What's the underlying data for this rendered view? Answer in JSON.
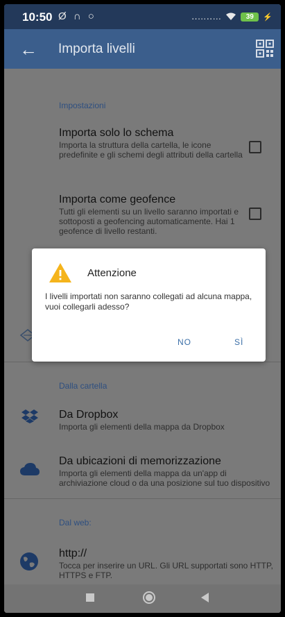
{
  "status_bar": {
    "time": "10:50",
    "left_icons": "Ø ∩ ○",
    "battery": "39",
    "signal": "‥…‥…",
    "charging": "⚡"
  },
  "app_bar": {
    "title": "Importa livelli"
  },
  "settings": {
    "header": "Impostazioni",
    "items": [
      {
        "title": "Importa solo lo schema",
        "description": "Importa la struttura della cartella, le icone predefinite e gli schemi degli attributi della cartella"
      },
      {
        "title": "Importa come geofence",
        "description": "Tutti gli elementi su un livello saranno importati e sottoposti a geofencing automaticamente. Hai 1 geofence di livello restanti."
      }
    ]
  },
  "folder_section": {
    "header": "Dalla cartella",
    "items": [
      {
        "title": "Da Dropbox",
        "description": "Importa gli elementi della mappa da Dropbox"
      },
      {
        "title": "Da ubicazioni di memorizzazione",
        "description": "Importa gli elementi della mappa da un'app di archiviazione cloud o da una posizione sul tuo dispositivo"
      }
    ]
  },
  "web_section": {
    "header": "Dal web:",
    "items": [
      {
        "title": "http://",
        "description": "Tocca per inserire un URL. Gli URL supportati sono HTTP, HTTPS e FTP."
      }
    ]
  },
  "dialog": {
    "title": "Attenzione",
    "message": "I livelli importati non saranno collegati ad alcuna mappa, vuoi collegarli adesso?",
    "no_label": "NO",
    "yes_label": "SÌ"
  },
  "colors": {
    "app_bar": "#3b5e8c",
    "status_bar": "#23395a",
    "accent": "#3b6fa8",
    "warning": "#f5b41c"
  }
}
